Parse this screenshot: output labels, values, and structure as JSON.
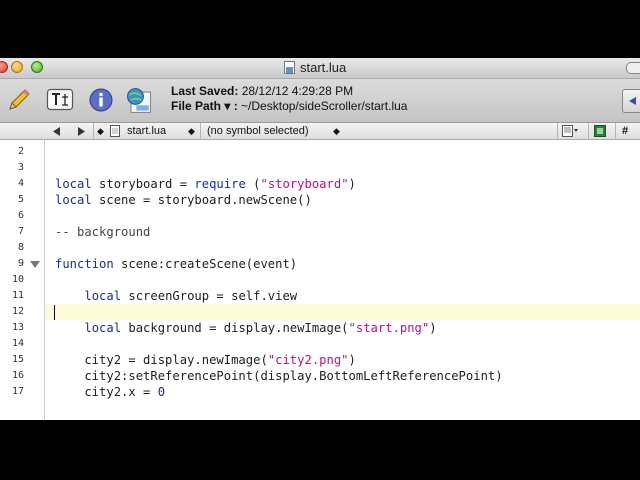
{
  "window": {
    "title": "start.lua"
  },
  "toolbar": {
    "last_saved_label": "Last Saved:",
    "last_saved_value": "28/12/12 4:29:28 PM",
    "file_path_label": "File Path ▾ :",
    "file_path_value": "~/Desktop/sideScroller/start.lua"
  },
  "navbar": {
    "file_name": "start.lua",
    "symbol": "(no symbol selected)",
    "hash": "#"
  },
  "editor": {
    "lines": [
      {
        "n": "2"
      },
      {
        "n": "3"
      },
      {
        "n": "4",
        "parts": [
          {
            "t": "local",
            "c": "kw"
          },
          {
            "t": " storyboard = "
          },
          {
            "t": "require",
            "c": "kw"
          },
          {
            "t": " ("
          },
          {
            "t": "\"storyboard\"",
            "c": "str"
          },
          {
            "t": ")"
          }
        ]
      },
      {
        "n": "5",
        "parts": [
          {
            "t": "local",
            "c": "kw"
          },
          {
            "t": " scene = storyboard.newScene()"
          }
        ]
      },
      {
        "n": "6"
      },
      {
        "n": "7",
        "parts": [
          {
            "t": "-- background",
            "c": "cm"
          }
        ]
      },
      {
        "n": "8"
      },
      {
        "n": "9",
        "fold": true,
        "parts": [
          {
            "t": "function",
            "c": "kw"
          },
          {
            "t": " scene:createScene(event)"
          }
        ]
      },
      {
        "n": "10"
      },
      {
        "n": "11",
        "parts": [
          {
            "t": "    "
          },
          {
            "t": "local",
            "c": "kw"
          },
          {
            "t": " screenGroup = self.view"
          }
        ]
      },
      {
        "n": "12",
        "current": true
      },
      {
        "n": "13",
        "parts": [
          {
            "t": "    "
          },
          {
            "t": "local",
            "c": "kw"
          },
          {
            "t": " background = display.newImage("
          },
          {
            "t": "\"start.png\"",
            "c": "str"
          },
          {
            "t": ")"
          }
        ]
      },
      {
        "n": "14"
      },
      {
        "n": "15",
        "parts": [
          {
            "t": "    city2 = display.newImage("
          },
          {
            "t": "\"city2.png\"",
            "c": "str"
          },
          {
            "t": ")"
          }
        ]
      },
      {
        "n": "16",
        "parts": [
          {
            "t": "    city2:setReferencePoint(display.BottomLeftReferencePoint)"
          }
        ]
      },
      {
        "n": "17",
        "parts": [
          {
            "t": "    city2.x = "
          },
          {
            "t": "0",
            "c": "num"
          }
        ]
      }
    ]
  }
}
